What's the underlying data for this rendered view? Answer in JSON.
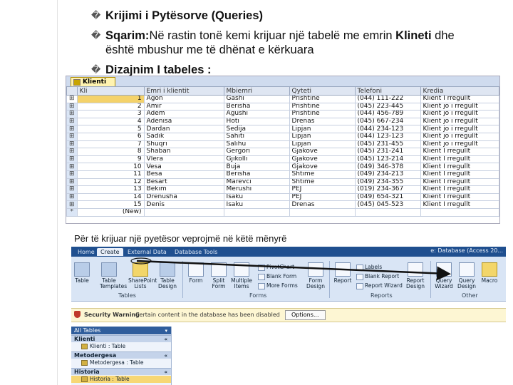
{
  "bullets": {
    "glyph": "�",
    "b1": "Krijimi i Pytësorve (Queries)",
    "b2_bold": "Sqarim:",
    "b2_mid": "Në rastin tonë kemi krijuar një tabelë me emrin ",
    "b2_bold2": "Klineti",
    "b2_end": " dhe",
    "b2_line2": "është mbushur me të dhënat e kërkuara",
    "b3": "Dizajnim I tabeles :"
  },
  "table_shot": {
    "tab_label": "Klienti",
    "columns": [
      "Kli",
      "Emri i klientit",
      "Mbiemri",
      "Qyteti",
      "Telefoni",
      "Kredia"
    ],
    "rows": [
      [
        "1",
        "Agon",
        "Gashi",
        "Prishtine",
        "(044) 111-222",
        "Klient I rregullt"
      ],
      [
        "2",
        "Amir",
        "Berisha",
        "Prishtine",
        "(045) 223-445",
        "Klient jo i rregullt"
      ],
      [
        "3",
        "Adem",
        "Agushi",
        "Prishtine",
        "(044) 456-789",
        "Klient jo i rregullt"
      ],
      [
        "4",
        "Adenisa",
        "Hoti",
        "Drenas",
        "(045) 667-234",
        "Klient jo i rregullt"
      ],
      [
        "5",
        "Dardan",
        "Sedija",
        "Lipjan",
        "(044) 234-123",
        "Klient jo i rregullt"
      ],
      [
        "6",
        "Sadik",
        "Sahiti",
        "Lipjan",
        "(044) 123-123",
        "Klient jo i rregullt"
      ],
      [
        "7",
        "Shuqri",
        "Salihu",
        "Lipjan",
        "(045) 231-455",
        "Klient jo i rregullt"
      ],
      [
        "8",
        "Shaban",
        "Gergori",
        "Gjakove",
        "(045) 231-241",
        "Klient I rregullt"
      ],
      [
        "9",
        "Vlera",
        "Gjikolli",
        "Gjakove",
        "(045) 123-214",
        "Klient I rregullt"
      ],
      [
        "10",
        "Vesa",
        "Buja",
        "Gjakove",
        "(049) 346-378",
        "Klient I rregullt"
      ],
      [
        "11",
        "Besa",
        "Berisha",
        "Shtime",
        "(049) 234-213",
        "Klient I rregullt"
      ],
      [
        "12",
        "Besart",
        "Marevci",
        "Shtime",
        "(049) 234-355",
        "Klient I rregullt"
      ],
      [
        "13",
        "Bekim",
        "Merushi",
        "PEJ",
        "(019) 234-367",
        "Klient I rregullt"
      ],
      [
        "14",
        "Drenusha",
        "Isaku",
        "PEJ",
        "(049) 654-321",
        "Klient I rregullt"
      ],
      [
        "15",
        "Denis",
        "Isaku",
        "Drenas",
        "(045) 045-523",
        "Klient I rregullt"
      ]
    ],
    "new_row": "(New)",
    "new_marker": "*"
  },
  "caption": "Për të krijuar një pyetësor veprojmë në këtë mënyrë",
  "ribbon_shot": {
    "tabs": [
      "Home",
      "Create",
      "External Data",
      "Database Tools"
    ],
    "title_right": "e: Database (Access 20...",
    "buttons": {
      "table": "Table",
      "table_templates": "Table Templates",
      "sharepoint_lists": "SharePoint Lists",
      "table_design": "Table Design",
      "form": "Form",
      "split_form": "Split Form",
      "multiple_items": "Multiple Items",
      "more_forms": "More Forms",
      "pivotchart": "PivotChart",
      "blank_form": "Blank Form",
      "form_design": "Form Design",
      "report": "Report",
      "labels": "Labels",
      "blank_report": "Blank Report",
      "report_wizard": "Report Wizard",
      "report_design": "Report Design",
      "query_wizard": "Query Wizard",
      "query_design": "Query Design",
      "macro": "Macro"
    },
    "groups": [
      "Tables",
      "Forms",
      "Reports",
      "Other"
    ],
    "security": {
      "title": "Security Warning",
      "message": "Certain content in the database has been disabled",
      "options": "Options..."
    },
    "nav": {
      "header": "All Tables",
      "groups": [
        "Klienti",
        "Metodergesa",
        "Historia"
      ],
      "items": [
        "Klienti : Table",
        "Metodergesa : Table",
        "Historia : Table"
      ]
    }
  }
}
